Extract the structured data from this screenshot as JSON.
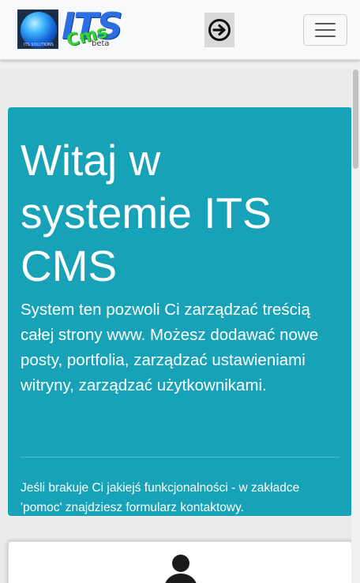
{
  "navbar": {
    "logo": {
      "brand": "ITS",
      "sub": "Cms",
      "tag": "beta",
      "globe_caption": "ITS SOLUTIONS"
    },
    "login_icon": "arrow-right-circle-icon",
    "menu_icon": "hamburger-menu-icon"
  },
  "jumbotron": {
    "title": "Witaj w systemie ITS CMS",
    "lead": "System ten pozwoli Ci zarządzać treścią całej strony www. Możesz dodawać nowe posty, portfolia, zarządzać ustawieniami witryny, zarządzać użytkownikami.",
    "note": "Jeśli brakuje Ci jakiejś funkcjonalności - w zakładce 'pomoc' znajdziesz formularz kontaktowy.",
    "background_color": "#17a2b8"
  },
  "card": {
    "icon": "user-icon"
  }
}
